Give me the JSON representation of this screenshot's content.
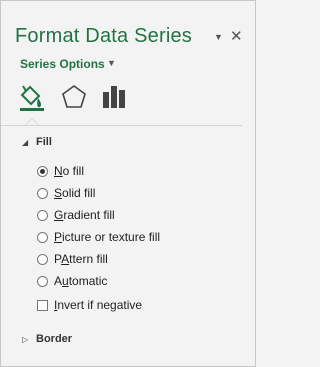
{
  "pane": {
    "title": "Format Data Series",
    "dropdown_icon": "dropdown-arrow-icon",
    "close_icon": "close-icon",
    "close_glyph": "✕",
    "dropdown_glyph": "▼"
  },
  "series_options": {
    "label": "Series Options",
    "caret_glyph": "▼"
  },
  "tabs": [
    {
      "name": "Fill & Line",
      "icon": "paint-bucket-icon",
      "active": true
    },
    {
      "name": "Effects",
      "icon": "pentagon-icon",
      "active": false
    },
    {
      "name": "Series Options",
      "icon": "bar-chart-icon",
      "active": false
    }
  ],
  "fill": {
    "label": "Fill",
    "expanded": true,
    "options": [
      {
        "access": "N",
        "rest": "o fill",
        "checked": true
      },
      {
        "access": "S",
        "rest": "olid fill",
        "checked": false
      },
      {
        "access": "G",
        "rest": "radient fill",
        "checked": false
      },
      {
        "access": "P",
        "rest": "icture or texture fill",
        "checked": false
      },
      {
        "access": "A",
        "rest": "ttern fill",
        "prefix": "P",
        "checked": false
      },
      {
        "access": "u",
        "rest": "tomatic",
        "prefix": "A",
        "checked": false
      }
    ],
    "invert_if_negative": {
      "access": "I",
      "rest": "nvert if negative",
      "checked": false
    }
  },
  "border": {
    "label": "Border",
    "expanded": false
  },
  "colors": {
    "accent": "#217346",
    "background": "#f3f3f3"
  }
}
